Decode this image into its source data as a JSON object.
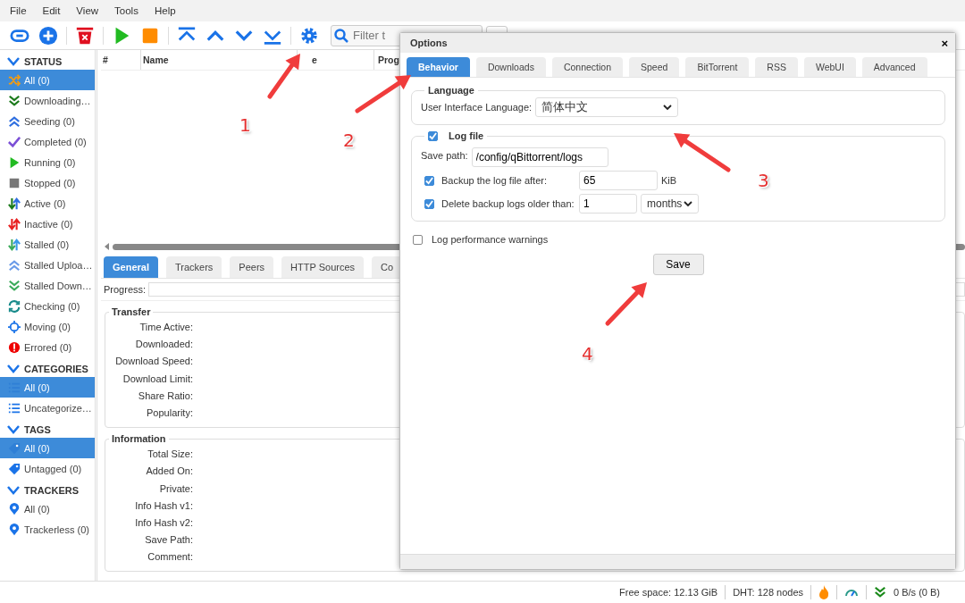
{
  "menu": [
    "File",
    "Edit",
    "View",
    "Tools",
    "Help"
  ],
  "toolbar": {
    "filter_placeholder": "Filter t"
  },
  "sidebar": [
    {
      "title": "STATUS",
      "items": [
        {
          "kind": "all",
          "label": "All (0)",
          "selected": true
        },
        {
          "kind": "downloading",
          "label": "Downloading…",
          "selected": false
        },
        {
          "kind": "seeding",
          "label": "Seeding (0)",
          "selected": false
        },
        {
          "kind": "completed",
          "label": "Completed (0)",
          "selected": false
        },
        {
          "kind": "running",
          "label": "Running (0)",
          "selected": false
        },
        {
          "kind": "stopped",
          "label": "Stopped (0)",
          "selected": false
        },
        {
          "kind": "active",
          "label": "Active (0)",
          "selected": false
        },
        {
          "kind": "inactive",
          "label": "Inactive (0)",
          "selected": false
        },
        {
          "kind": "stalled",
          "label": "Stalled (0)",
          "selected": false
        },
        {
          "kind": "stalled_up",
          "label": "Stalled Uploa…",
          "selected": false
        },
        {
          "kind": "stalled_down",
          "label": "Stalled Down…",
          "selected": false
        },
        {
          "kind": "checking",
          "label": "Checking (0)",
          "selected": false
        },
        {
          "kind": "moving",
          "label": "Moving (0)",
          "selected": false
        },
        {
          "kind": "errored",
          "label": "Errored (0)",
          "selected": false
        }
      ]
    },
    {
      "title": "CATEGORIES",
      "items": [
        {
          "kind": "list",
          "label": "All (0)",
          "selected": true
        },
        {
          "kind": "list",
          "label": "Uncategorize…",
          "selected": false
        }
      ]
    },
    {
      "title": "TAGS",
      "items": [
        {
          "kind": "tag",
          "label": "All (0)",
          "selected": true
        },
        {
          "kind": "tag",
          "label": "Untagged (0)",
          "selected": false
        }
      ]
    },
    {
      "title": "TRACKERS",
      "items": [
        {
          "kind": "pin",
          "label": "All (0)",
          "selected": false
        },
        {
          "kind": "pin",
          "label": "Trackerless (0)",
          "selected": false
        }
      ]
    }
  ],
  "table": {
    "columns": [
      "#",
      "Name",
      "e",
      "Prog"
    ]
  },
  "detail_tabs": [
    {
      "label": "General",
      "selected": true
    },
    {
      "label": "Trackers",
      "selected": false
    },
    {
      "label": "Peers",
      "selected": false
    },
    {
      "label": "HTTP Sources",
      "selected": false
    },
    {
      "label": "Co",
      "selected": false
    }
  ],
  "progress": {
    "label": "Progress:",
    "level": 0
  },
  "transfer": {
    "title": "Transfer",
    "fields": [
      "Time Active:",
      "Downloaded:",
      "Download Speed:",
      "Download Limit:",
      "Share Ratio:",
      "Popularity:"
    ]
  },
  "information": {
    "title": "Information",
    "fields": [
      "Total Size:",
      "Added On:",
      "Private:",
      "Info Hash v1:",
      "Info Hash v2:",
      "Save Path:",
      "Comment:"
    ]
  },
  "status_bar": {
    "free_space": "Free space: 12.13 GiB",
    "dht": "DHT: 128 nodes",
    "download": "0 B/s (0 B)"
  },
  "dialog": {
    "title": "Options",
    "close": "×",
    "tabs": [
      {
        "label": "Behavior",
        "selected": true
      },
      {
        "label": "Downloads",
        "selected": false
      },
      {
        "label": "Connection",
        "selected": false
      },
      {
        "label": "Speed",
        "selected": false
      },
      {
        "label": "BitTorrent",
        "selected": false
      },
      {
        "label": "RSS",
        "selected": false
      },
      {
        "label": "WebUI",
        "selected": false
      },
      {
        "label": "Advanced",
        "selected": false
      }
    ],
    "language": {
      "legend": "Language",
      "label": "User Interface Language:",
      "value": "简体中文"
    },
    "log_file": {
      "legend": "Log file",
      "checked": true,
      "save_path_label": "Save path:",
      "save_path": "/config/qBittorrent/logs",
      "backup": {
        "checked": true,
        "label": "Backup the log file after:",
        "value": "65",
        "unit": "KiB"
      },
      "delete": {
        "checked": true,
        "label": "Delete backup logs older than:",
        "value": "1",
        "unit": "months"
      }
    },
    "performance": {
      "checked": false,
      "label": "Log performance warnings"
    },
    "save": "Save"
  },
  "annotations": [
    "1",
    "2",
    "3",
    "4"
  ]
}
